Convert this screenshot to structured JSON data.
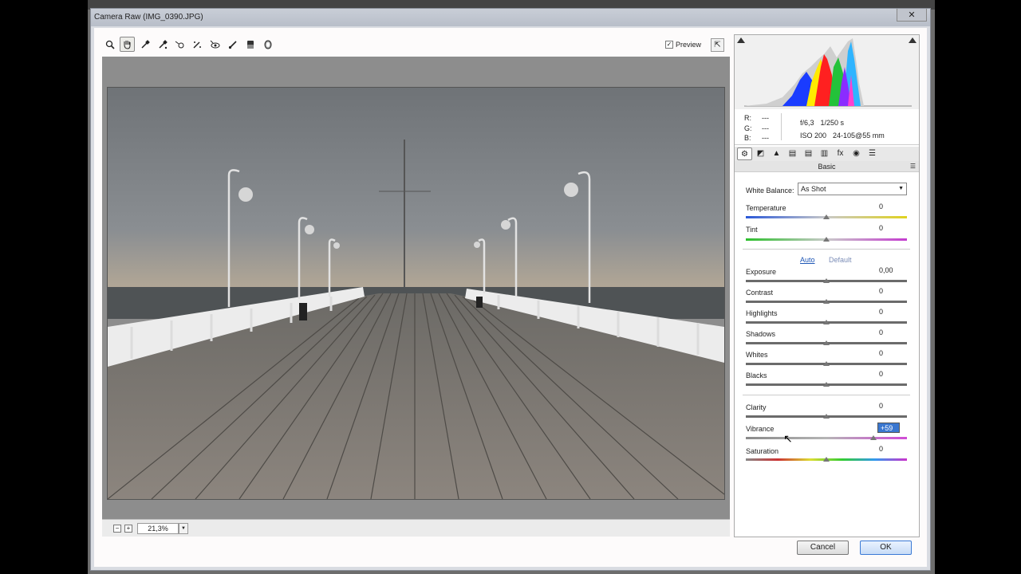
{
  "window": {
    "title": "Camera Raw (IMG_0390.JPG)",
    "close_glyph": "✕"
  },
  "toolbar": {
    "tools": [
      {
        "name": "zoom-tool-icon",
        "glyph": "🔍"
      },
      {
        "name": "hand-tool-icon",
        "glyph": "✋"
      },
      {
        "name": "white-balance-tool-icon",
        "glyph": "✒"
      },
      {
        "name": "color-sampler-tool-icon",
        "glyph": "✒"
      },
      {
        "name": "targeted-adjustment-tool-icon",
        "glyph": "⊕"
      },
      {
        "name": "spot-removal-tool-icon",
        "glyph": "✎"
      },
      {
        "name": "red-eye-tool-icon",
        "glyph": "👁"
      },
      {
        "name": "adjustment-brush-icon",
        "glyph": "🖌"
      },
      {
        "name": "graduated-filter-icon",
        "glyph": "▮"
      },
      {
        "name": "radial-filter-icon",
        "glyph": "◎"
      }
    ],
    "preview_label": "Preview",
    "preview_checked": "✓",
    "fullscreen_glyph": "⇱"
  },
  "zoom": {
    "minus": "−",
    "plus": "+",
    "value": "21,3%",
    "dropdown": "▼"
  },
  "info": {
    "rgb_labels": [
      "R:",
      "G:",
      "B:"
    ],
    "rgb_values": [
      "---",
      "---",
      "---"
    ],
    "aperture": "f/6,3",
    "shutter": "1/250 s",
    "iso": "ISO 200",
    "lens": "24-105@55 mm"
  },
  "panel": {
    "tabs": [
      "⚙",
      "◩",
      "▲",
      "▤",
      "▤",
      "▥",
      "fx",
      "◉",
      "☰"
    ],
    "section_title": "Basic",
    "section_menu": "☰",
    "white_balance_label": "White Balance:",
    "white_balance_value": "As Shot",
    "auto": "Auto",
    "default": "Default",
    "temperature": {
      "label": "Temperature",
      "value": "0"
    },
    "tint": {
      "label": "Tint",
      "value": "0"
    },
    "exposure": {
      "label": "Exposure",
      "value": "0,00"
    },
    "contrast": {
      "label": "Contrast",
      "value": "0"
    },
    "highlights": {
      "label": "Highlights",
      "value": "0"
    },
    "shadows": {
      "label": "Shadows",
      "value": "0"
    },
    "whites": {
      "label": "Whites",
      "value": "0"
    },
    "blacks": {
      "label": "Blacks",
      "value": "0"
    },
    "clarity": {
      "label": "Clarity",
      "value": "0"
    },
    "vibrance": {
      "label": "Vibrance",
      "value": "+59"
    },
    "saturation": {
      "label": "Saturation",
      "value": "0"
    }
  },
  "buttons": {
    "cancel": "Cancel",
    "ok": "OK"
  },
  "colors": {
    "accent": "#3a77d0",
    "link": "#1f57b6"
  }
}
